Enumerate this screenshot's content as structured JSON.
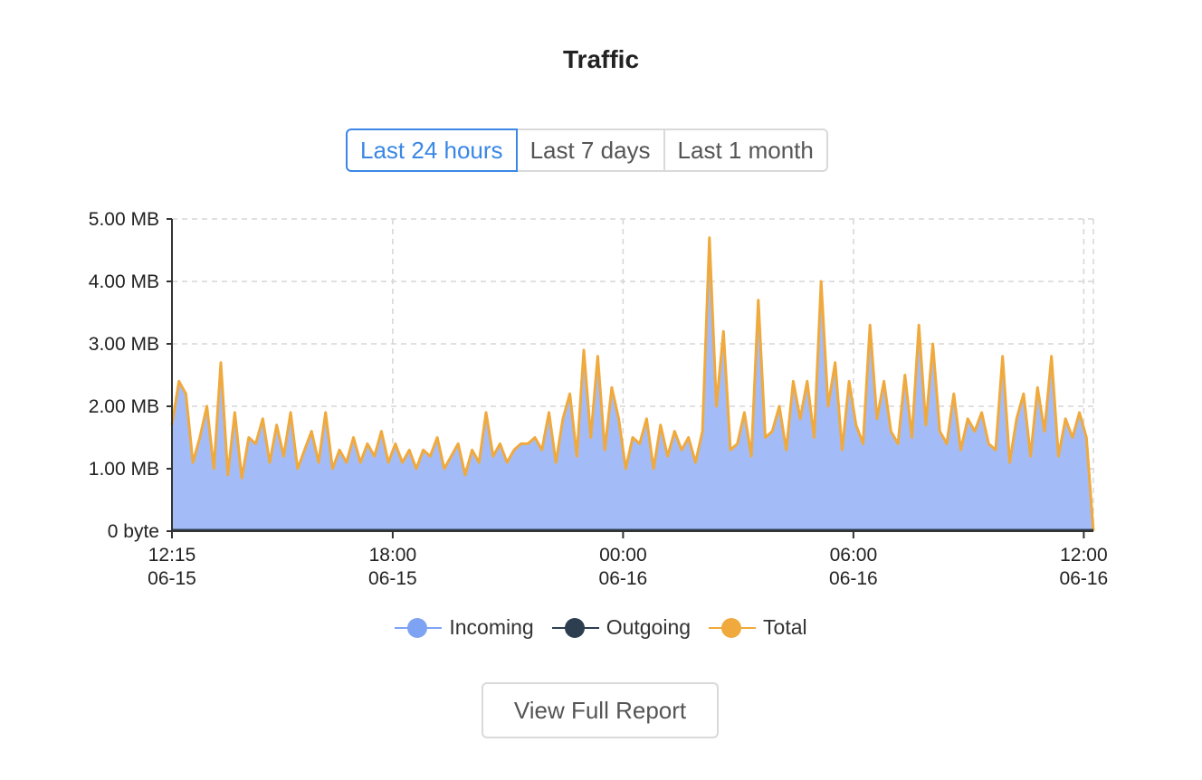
{
  "title": "Traffic",
  "tabs": [
    {
      "label": "Last 24 hours",
      "active": true
    },
    {
      "label": "Last 7 days",
      "active": false
    },
    {
      "label": "Last 1 month",
      "active": false
    }
  ],
  "button": {
    "label": "View Full Report"
  },
  "colors": {
    "incoming": "#a3bcf8",
    "incoming_line": "#7fa3f3",
    "outgoing": "#2c3e50",
    "total": "#f0a93c",
    "grid": "#d5d5d5"
  },
  "chart_data": {
    "type": "area",
    "ylim": [
      0,
      5
    ],
    "y_ticks": [
      {
        "value": 0,
        "label": "0 byte"
      },
      {
        "value": 1,
        "label": "1.00 MB"
      },
      {
        "value": 2,
        "label": "2.00 MB"
      },
      {
        "value": 3,
        "label": "3.00 MB"
      },
      {
        "value": 4,
        "label": "4.00 MB"
      },
      {
        "value": 5,
        "label": "5.00 MB"
      }
    ],
    "x_range": [
      "06-15 12:15",
      "06-16 12:15"
    ],
    "x_ticks": [
      {
        "value": 0,
        "time": "12:15",
        "date": "06-15"
      },
      {
        "value": 5.75,
        "time": "18:00",
        "date": "06-15"
      },
      {
        "value": 11.75,
        "time": "00:00",
        "date": "06-16"
      },
      {
        "value": 17.75,
        "time": "06:00",
        "date": "06-16"
      },
      {
        "value": 23.75,
        "time": "12:00",
        "date": "06-16"
      }
    ],
    "grid": true,
    "legend": "bottom",
    "series": [
      {
        "name": "Incoming",
        "values": [
          1.7,
          2.4,
          2.2,
          1.1,
          1.5,
          2.0,
          1.0,
          2.7,
          0.9,
          1.9,
          0.85,
          1.5,
          1.4,
          1.8,
          1.1,
          1.7,
          1.2,
          1.9,
          1.0,
          1.3,
          1.6,
          1.1,
          1.9,
          1.0,
          1.3,
          1.1,
          1.5,
          1.1,
          1.4,
          1.2,
          1.6,
          1.1,
          1.4,
          1.1,
          1.3,
          1.0,
          1.3,
          1.2,
          1.5,
          1.0,
          1.2,
          1.4,
          0.9,
          1.3,
          1.1,
          1.9,
          1.2,
          1.4,
          1.1,
          1.3,
          1.4,
          1.4,
          1.5,
          1.3,
          1.9,
          1.1,
          1.8,
          2.2,
          1.2,
          2.9,
          1.5,
          2.8,
          1.3,
          2.3,
          1.8,
          1.0,
          1.5,
          1.4,
          1.8,
          1.0,
          1.7,
          1.2,
          1.6,
          1.3,
          1.5,
          1.1,
          1.6,
          4.7,
          2.0,
          3.2,
          1.3,
          1.4,
          1.9,
          1.2,
          3.7,
          1.5,
          1.6,
          2.0,
          1.3,
          2.4,
          1.8,
          2.4,
          1.5,
          4.0,
          2.0,
          2.7,
          1.3,
          2.4,
          1.7,
          1.4,
          3.3,
          1.8,
          2.4,
          1.6,
          1.4,
          2.5,
          1.5,
          3.3,
          1.7,
          3.0,
          1.6,
          1.4,
          2.2,
          1.3,
          1.8,
          1.6,
          1.9,
          1.4,
          1.3,
          2.8,
          1.1,
          1.8,
          2.2,
          1.2,
          2.3,
          1.6,
          2.8,
          1.2,
          1.8,
          1.5,
          1.9,
          1.5,
          0
        ],
        "note_incoming_follows_total": true
      },
      {
        "name": "Outgoing",
        "values": [
          0.02,
          0.02,
          0.02,
          0.02,
          0.02,
          0.02,
          0.02,
          0.02,
          0.02,
          0.02,
          0.02,
          0.02
        ]
      },
      {
        "name": "Total",
        "values": [
          1.7,
          2.4,
          2.2,
          1.1,
          1.5,
          2.0,
          1.0,
          2.7,
          0.9,
          1.9,
          0.85,
          1.5,
          1.4,
          1.8,
          1.1,
          1.7,
          1.2,
          1.9,
          1.0,
          1.3,
          1.6,
          1.1,
          1.9,
          1.0,
          1.3,
          1.1,
          1.5,
          1.1,
          1.4,
          1.2,
          1.6,
          1.1,
          1.4,
          1.1,
          1.3,
          1.0,
          1.3,
          1.2,
          1.5,
          1.0,
          1.2,
          1.4,
          0.9,
          1.3,
          1.1,
          1.9,
          1.2,
          1.4,
          1.1,
          1.3,
          1.4,
          1.4,
          1.5,
          1.3,
          1.9,
          1.1,
          1.8,
          2.2,
          1.2,
          2.9,
          1.5,
          2.8,
          1.3,
          2.3,
          1.8,
          1.0,
          1.5,
          1.4,
          1.8,
          1.0,
          1.7,
          1.2,
          1.6,
          1.3,
          1.5,
          1.1,
          1.6,
          4.7,
          2.0,
          3.2,
          1.3,
          1.4,
          1.9,
          1.2,
          3.7,
          1.5,
          1.6,
          2.0,
          1.3,
          2.4,
          1.8,
          2.4,
          1.5,
          4.0,
          2.0,
          2.7,
          1.3,
          2.4,
          1.7,
          1.4,
          3.3,
          1.8,
          2.4,
          1.6,
          1.4,
          2.5,
          1.5,
          3.3,
          1.7,
          3.0,
          1.6,
          1.4,
          2.2,
          1.3,
          1.8,
          1.6,
          1.9,
          1.4,
          1.3,
          2.8,
          1.1,
          1.8,
          2.2,
          1.2,
          2.3,
          1.6,
          2.8,
          1.2,
          1.8,
          1.5,
          1.9,
          1.5,
          0
        ]
      }
    ]
  }
}
